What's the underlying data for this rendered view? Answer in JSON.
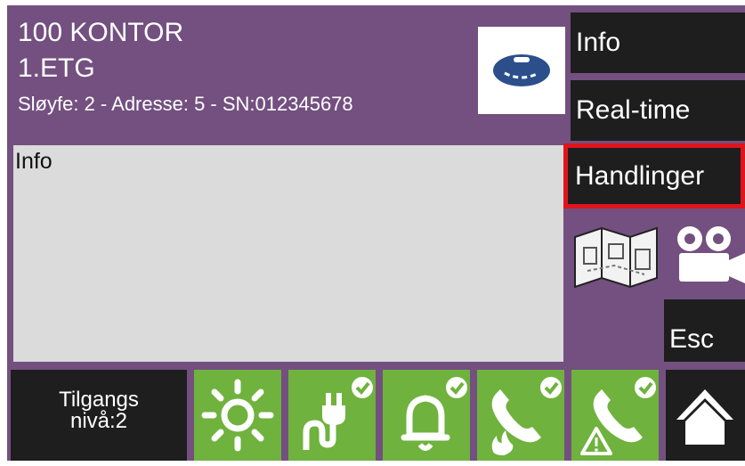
{
  "header": {
    "zone_name": "100 KONTOR",
    "floor": "1.ETG",
    "device_info": "Sløyfe: 2 - Adresse: 5 - SN:012345678"
  },
  "info_panel": {
    "label": "Info"
  },
  "menu": {
    "info_label": "Info",
    "realtime_label": "Real-time",
    "actions_label": "Handlinger",
    "esc_label": "Esc"
  },
  "status_bar": {
    "access_line1": "Tilgangs",
    "access_line2": "nivå:2",
    "icons": [
      "day-mode-sun-icon",
      "power-ok-icon",
      "alarm-bell-ok-icon",
      "fire-call-ok-icon",
      "fault-call-ok-icon"
    ]
  },
  "colors": {
    "background": "#735080",
    "button": "#1e1e1e",
    "status_green": "#6fb23d",
    "selected_border": "#e0141c",
    "info_area": "#dbdbdb",
    "detector": "#2c4f8c"
  }
}
